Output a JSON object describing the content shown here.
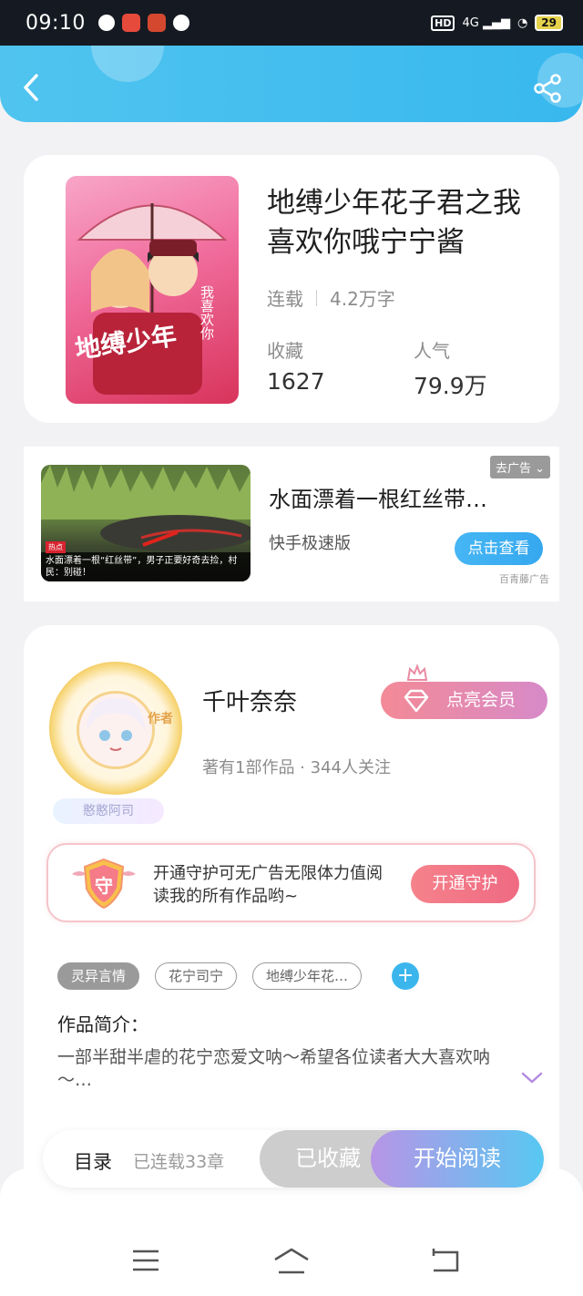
{
  "status_bar": {
    "time": "09:10",
    "network": "4G",
    "hd": "HD",
    "battery": "29"
  },
  "header": {
    "back_icon": "chevron-left-icon",
    "share_icon": "share-icon"
  },
  "book": {
    "title": "地缚少年花子君之我喜欢你哦宁宁酱",
    "status": "连载",
    "word_count": "4.2万字",
    "favorites_label": "收藏",
    "favorites_value": "1627",
    "popularity_label": "人气",
    "popularity_value": "79.9万"
  },
  "ad": {
    "title": "水面漂着一根红丝带…",
    "source": "快手极速版",
    "cta": "点击查看",
    "close_label": "去广告",
    "brand": "百青藤广告",
    "image_hot_tag": "热点",
    "image_caption": "水面漂着一根“红丝带”，男子正要好奇去捡，村民：别碰！"
  },
  "author": {
    "name": "千叶奈奈",
    "meta": "著有1部作品 · 344人关注",
    "avatar_tag": "作者",
    "badge": "憨憨阿司",
    "vip_button": "点亮会员"
  },
  "guard": {
    "shield_char": "守",
    "text": "开通守护可无广告无限体力值阅读我的所有作品哟~",
    "button": "开通守护"
  },
  "tags": {
    "items": [
      "灵异言情",
      "花宁司宁",
      "地缚少年花…"
    ],
    "add": "+"
  },
  "intro": {
    "title": "作品简介：",
    "text": "一部半甜半虐的花宁恋爱文呐～希望各位读者大大喜欢呐～…"
  },
  "action_bar": {
    "toc_label": "目录",
    "toc_count": "已连载33章",
    "favorited": "已收藏",
    "start_reading": "开始阅读"
  },
  "colors": {
    "header_blue": "#3eb9ee",
    "accent_pink": "#ef6a82",
    "read_gradient_start": "#b795e6",
    "read_gradient_end": "#57c8f2"
  }
}
